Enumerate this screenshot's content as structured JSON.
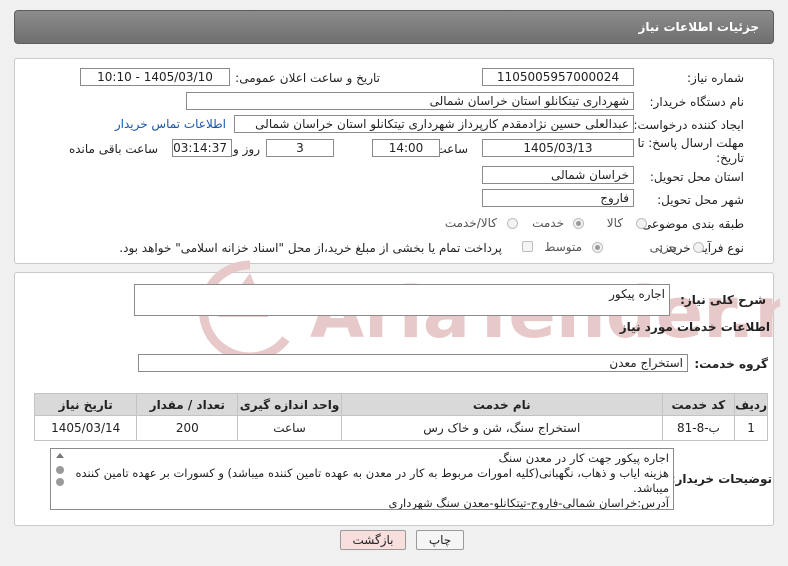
{
  "header": {
    "title": "جزئیات اطلاعات نیاز"
  },
  "form": {
    "need_number_label": "شماره نیاز:",
    "need_number": "1105005957000024",
    "announce_label": "تاریخ و ساعت اعلان عمومی:",
    "announce_value": "1405/03/10 - 10:10",
    "buyer_org_label": "نام دستگاه خریدار:",
    "buyer_org": "شهرداری تیتکانلو استان خراسان شمالی",
    "requester_label": "ایجاد کننده درخواست:",
    "requester": "عبدالعلی حسین نژادمقدم کارپرداز شهرداری تیتکانلو استان خراسان شمالی",
    "contact_link": "اطلاعات تماس خریدار",
    "deadline_label": "مهلت ارسال پاسخ: تا تاریخ:",
    "deadline_date": "1405/03/13",
    "time_label": "ساعت",
    "deadline_time": "14:00",
    "days_value": "3",
    "days_label": "روز و",
    "remaining_time": "03:14:37",
    "remaining_label": "ساعت باقی مانده",
    "province_label": "استان محل تحویل:",
    "province": "خراسان شمالی",
    "city_label": "شهر محل تحویل:",
    "city": "فاروج",
    "category_label": "طبقه بندی موضوعی:",
    "category_options": [
      "کالا",
      "خدمت",
      "کالا/خدمت"
    ],
    "purchase_type_label": "نوع فرآیند خرید :",
    "purchase_options": [
      "جزیی",
      "متوسط"
    ],
    "payment_note": "پرداخت تمام یا بخشی از مبلغ خرید،از محل \"اسناد خزانه اسلامی\" خواهد بود."
  },
  "summary": {
    "label": "شرح کلی نیاز:",
    "value": "اجاره پیکور"
  },
  "services": {
    "section_title": "اطلاعات خدمات مورد نیاز",
    "group_label": "گروه خدمت:",
    "group_value": "استخراج معدن",
    "columns": [
      "ردیف",
      "کد خدمت",
      "نام خدمت",
      "واحد اندازه گیری",
      "تعداد / مقدار",
      "تاریخ نیاز"
    ],
    "rows": [
      {
        "row": "1",
        "code": "ب-8-81",
        "name": "استخراج سنگ، شن و خاک رس",
        "unit": "ساعت",
        "qty": "200",
        "date": "1405/03/14"
      }
    ]
  },
  "buyer_notes": {
    "label": "توضیحات خریدار:",
    "lines": [
      "اجاره پیکور جهت کار در معدن سنگ",
      "هزینه ایاب و ذهاب، نگهبانی(کلیه امورات مربوط به کار در معدن به عهده تامین کننده میباشد) و کسورات بر عهده تامین کننده میباشد.",
      "آدرس:خراسان شمالی-فاروج-تیتکانلو-معدن سنگ شهرداری"
    ]
  },
  "buttons": {
    "print": "چاپ",
    "back": "بازگشت"
  },
  "watermark": {
    "text": "AriaTender.neT"
  },
  "colors": {
    "link": "#1a57a8",
    "back_button": "#f9dede",
    "header": "#7a7a7a",
    "watermark": "#e7c9c9"
  }
}
